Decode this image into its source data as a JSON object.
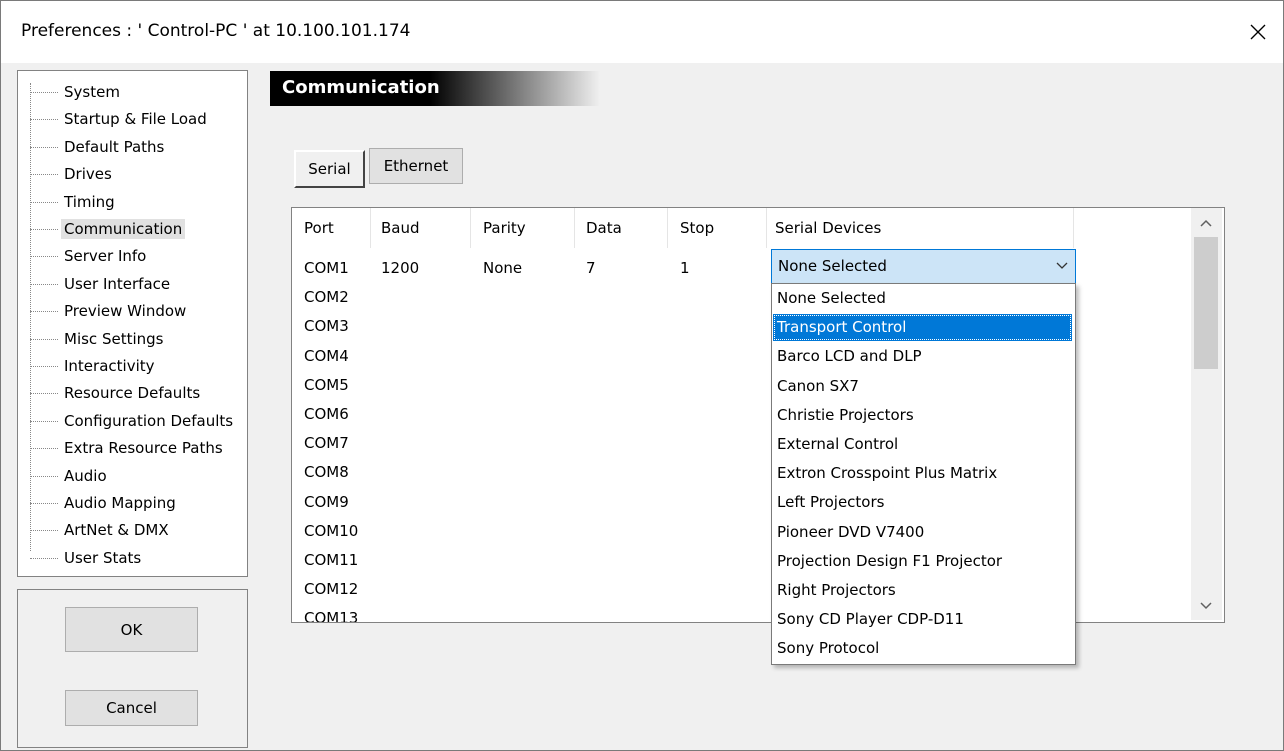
{
  "window": {
    "title": "Preferences  :  ' Control-PC '  at  10.100.101.174",
    "close_icon": "close-icon"
  },
  "tree": {
    "items": [
      {
        "label": "System"
      },
      {
        "label": "Startup & File Load"
      },
      {
        "label": "Default Paths"
      },
      {
        "label": "Drives"
      },
      {
        "label": "Timing"
      },
      {
        "label": "Communication"
      },
      {
        "label": "Server Info"
      },
      {
        "label": "User Interface"
      },
      {
        "label": "Preview Window"
      },
      {
        "label": "Misc Settings"
      },
      {
        "label": "Interactivity"
      },
      {
        "label": "Resource Defaults"
      },
      {
        "label": "Configuration Defaults"
      },
      {
        "label": "Extra Resource Paths"
      },
      {
        "label": "Audio"
      },
      {
        "label": "Audio Mapping"
      },
      {
        "label": "ArtNet & DMX"
      },
      {
        "label": "User Stats"
      }
    ],
    "selected": "Communication"
  },
  "buttons": {
    "ok": "OK",
    "cancel": "Cancel"
  },
  "section": {
    "title": "Communication"
  },
  "tabs": [
    {
      "label": "Serial"
    },
    {
      "label": "Ethernet"
    }
  ],
  "table": {
    "columns": [
      "Port",
      "Baud",
      "Parity",
      "Data",
      "Stop",
      "Serial Devices"
    ],
    "first_row": {
      "baud": "1200",
      "parity": "None",
      "data": "7",
      "stop": "1"
    },
    "ports": [
      "COM1",
      "COM2",
      "COM3",
      "COM4",
      "COM5",
      "COM6",
      "COM7",
      "COM8",
      "COM9",
      "COM10",
      "COM11",
      "COM12",
      "COM13"
    ]
  },
  "combo": {
    "value": "None Selected",
    "options": [
      "None Selected",
      "Transport Control",
      "Barco LCD and DLP",
      "Canon SX7",
      "Christie Projectors",
      "External Control",
      "Extron Crosspoint Plus Matrix",
      "Left Projectors",
      "Pioneer DVD V7400",
      "Projection Design F1 Projector",
      "Right Projectors",
      "Sony CD Player CDP-D11",
      "Sony Protocol"
    ],
    "highlighted": "Transport Control"
  },
  "colors": {
    "accent": "#0078d7",
    "combo_bg": "#cce4f7"
  }
}
